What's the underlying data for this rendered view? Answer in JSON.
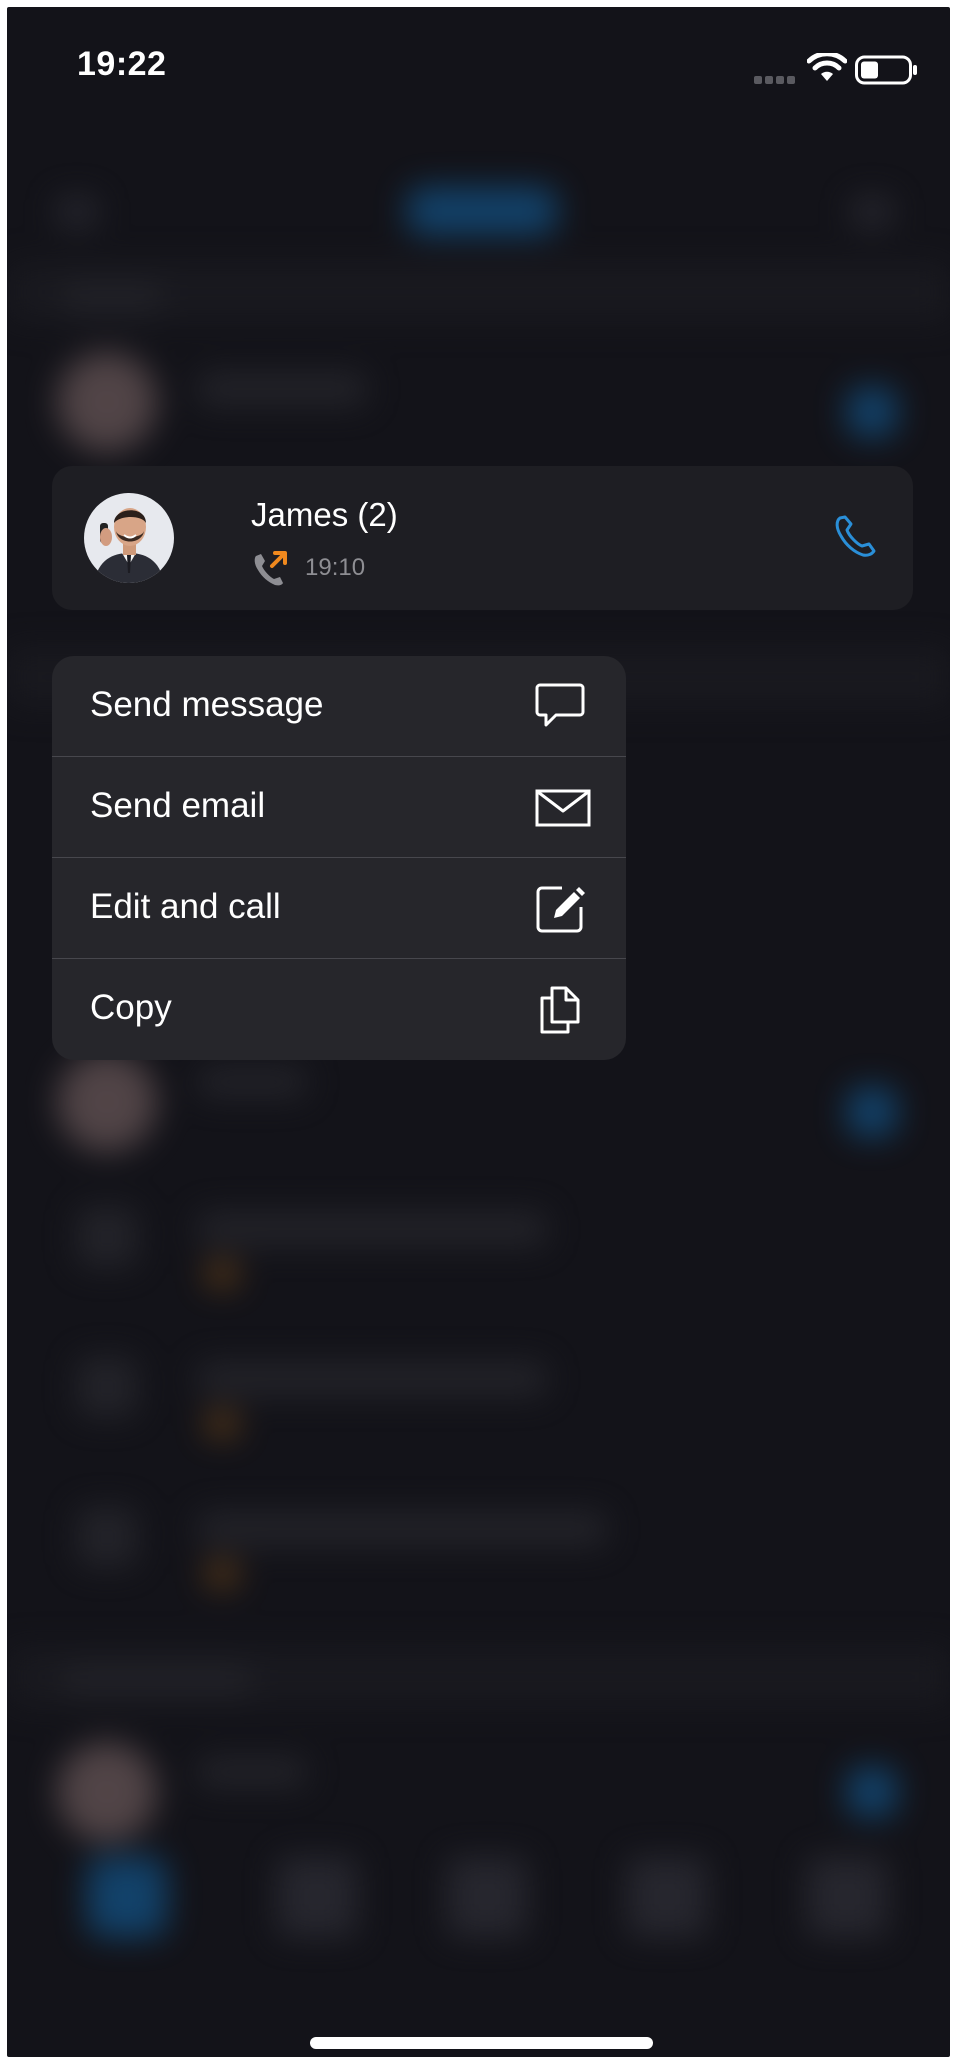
{
  "status_bar": {
    "time": "19:22",
    "icons": [
      "signal-icon",
      "wifi-icon",
      "battery-icon"
    ]
  },
  "contact_card": {
    "name": "James (2)",
    "time": "19:10",
    "call_direction_icon": "outgoing-call-icon",
    "action_icon": "phone-icon",
    "accent_color": "#2a8fd8",
    "outgoing_color": "#f0891e"
  },
  "context_menu": {
    "items": [
      {
        "label": "Send message",
        "icon": "message-icon"
      },
      {
        "label": "Send email",
        "icon": "email-icon"
      },
      {
        "label": "Edit and call",
        "icon": "edit-icon"
      },
      {
        "label": "Copy",
        "icon": "copy-icon"
      }
    ]
  },
  "colors": {
    "background": "#131319",
    "card": "#1e1e23",
    "menu": "#26262b",
    "secondary_text": "#8e8e93"
  }
}
